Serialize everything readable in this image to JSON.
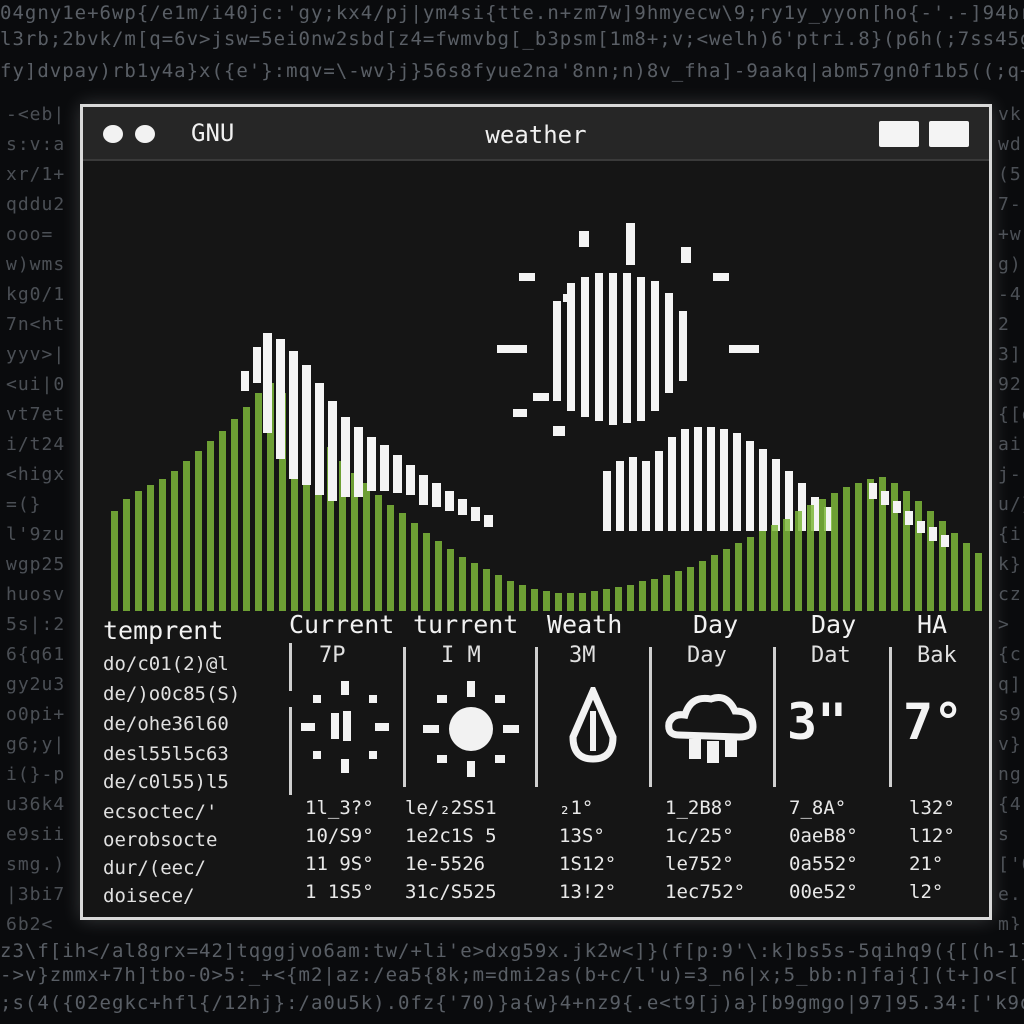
{
  "window": {
    "app_name": "GNU",
    "title": "weather"
  },
  "colors": {
    "hills": "#7db83a",
    "sky": "#151515",
    "frame": "#d9d9d9"
  },
  "icons": [
    "sun-icon",
    "cloud-icon",
    "mountain-icon",
    "raindrop-icon",
    "storm-cloud-icon"
  ],
  "forecast": {
    "row_label": "temprent",
    "columns": [
      {
        "header": "Current",
        "sub": "7P",
        "icon": "sun-icon"
      },
      {
        "header": "turrent",
        "sub": "I M",
        "icon": "sun-icon"
      },
      {
        "header": "Weath",
        "sub": "3M",
        "icon": "raindrop-icon"
      },
      {
        "header": "Day",
        "sub": "Day",
        "icon": "storm-cloud-icon"
      },
      {
        "header": "Day",
        "sub": "Dat",
        "big": "3\""
      },
      {
        "header": "HA",
        "sub": "Bak",
        "big": "7°"
      }
    ],
    "left_labels": [
      "do/c01(2)@l",
      "de/)o0c85(S)",
      "de/ohe36l60",
      "desl55l5c63",
      "de/c0l55)l5",
      "ecsoctec/'",
      "oerobsocte",
      "dur/(eec/",
      "doisece/"
    ],
    "rows": [
      [
        "1l_3?°",
        "le/₂2SS1",
        "₂1°",
        "1_2B8°",
        "7_8A°",
        "l32°"
      ],
      [
        "10/S9°",
        "1e2c1S 5",
        "13S°",
        "1c/25°",
        "0aeB8°",
        "l12°"
      ],
      [
        "11 9S°",
        "1e-5526",
        "1S12°",
        "le752°",
        "0a552°",
        "21°"
      ],
      [
        "1 1S5°",
        "31c/S525",
        "13!2°",
        "1ec752°",
        "00e52°",
        "l2°"
      ]
    ]
  }
}
